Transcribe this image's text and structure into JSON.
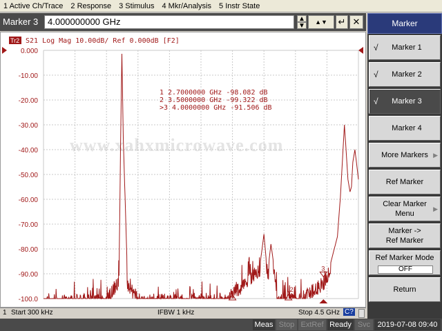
{
  "menu": [
    "1 Active Ch/Trace",
    "2 Response",
    "3 Stimulus",
    "4 Mkr/Analysis",
    "5 Instr State"
  ],
  "entry": {
    "label": "Marker 3",
    "value": "4.000000000 GHz",
    "buttons": {
      "step_up": "▲",
      "step_down": "▼",
      "enter": "↵",
      "close": "✕"
    }
  },
  "trace": {
    "badge": "Tr2",
    "header": "S21 Log Mag 10.00dB/ Ref 0.000dB [F2]",
    "color": "#a01818"
  },
  "y_axis": {
    "labels": [
      "0.000",
      "-10.00",
      "-20.00",
      "-30.00",
      "-40.00",
      "-50.00",
      "-60.00",
      "-70.00",
      "-80.00",
      "-90.00",
      "-100.0"
    ]
  },
  "marker_readout": [
    {
      "prefix": "1",
      "freq": "2.7000000 GHz",
      "value": "-98.082 dB"
    },
    {
      "prefix": "2",
      "freq": "3.5000000 GHz",
      "value": "-99.322 dB"
    },
    {
      "prefix": ">3",
      "freq": "4.0000000 GHz",
      "value": "-91.506 dB"
    }
  ],
  "watermark": "www.xahxmicrowave.com",
  "chart_data": {
    "type": "line",
    "ylim": [
      -100,
      0
    ],
    "xlim_ghz": [
      0.0003,
      4.5
    ],
    "series": [
      {
        "name": "",
        "x_ghz": [
          0.0003,
          0.5,
          0.9,
          1.08,
          1.1,
          1.12,
          1.14,
          1.2,
          1.4,
          2.0,
          2.6,
          3.1,
          3.15,
          3.2,
          3.25,
          3.35,
          3.45,
          3.5,
          3.6,
          3.7,
          3.8,
          3.9,
          4.0,
          4.1,
          4.2,
          4.24,
          4.27,
          4.3,
          4.35,
          4.38,
          4.4,
          4.42,
          4.45,
          4.5
        ],
        "values": [
          -99,
          -98,
          -98,
          -90,
          -40,
          -1,
          -35,
          -92,
          -98,
          -98,
          -98,
          -85,
          -74,
          -90,
          -78,
          -99,
          -97,
          -95,
          -99,
          -97,
          -95,
          -93,
          -91,
          -86,
          -75,
          -60,
          -45,
          -30,
          -52,
          -57,
          -55,
          -45,
          -40,
          -52
        ]
      }
    ],
    "markers": [
      {
        "label": "1",
        "x_ghz": 2.7,
        "value_db": -98.082
      },
      {
        "label": "2",
        "x_ghz": 3.5,
        "value_db": -99.322
      },
      {
        "label": "3",
        "x_ghz": 4.0,
        "value_db": -91.506
      }
    ],
    "grid": true
  },
  "channel_status": {
    "channel": "1",
    "start": "Start 300 kHz",
    "ifbw": "IFBW 1 kHz",
    "stop": "Stop 4.5 GHz",
    "badge": "C?"
  },
  "instrument_status": {
    "meas": "Meas",
    "stop": "Stop",
    "extref": "ExtRef",
    "ready": "Ready",
    "svc": "Svc",
    "datetime": "2019-07-08 09:40"
  },
  "softkeys": {
    "title": "Marker",
    "check": "√",
    "marker1": "Marker 1",
    "marker2": "Marker 2",
    "marker3": "Marker 3",
    "marker4": "Marker 4",
    "more_markers": "More Markers",
    "ref_marker": "Ref Marker",
    "clear_marker_line1": "Clear Marker",
    "clear_marker_line2": "Menu",
    "marker_to_ref_line1": "Marker ->",
    "marker_to_ref_line2": "Ref Marker",
    "ref_marker_mode": "Ref Marker Mode",
    "ref_marker_mode_value": "OFF",
    "return": "Return"
  }
}
